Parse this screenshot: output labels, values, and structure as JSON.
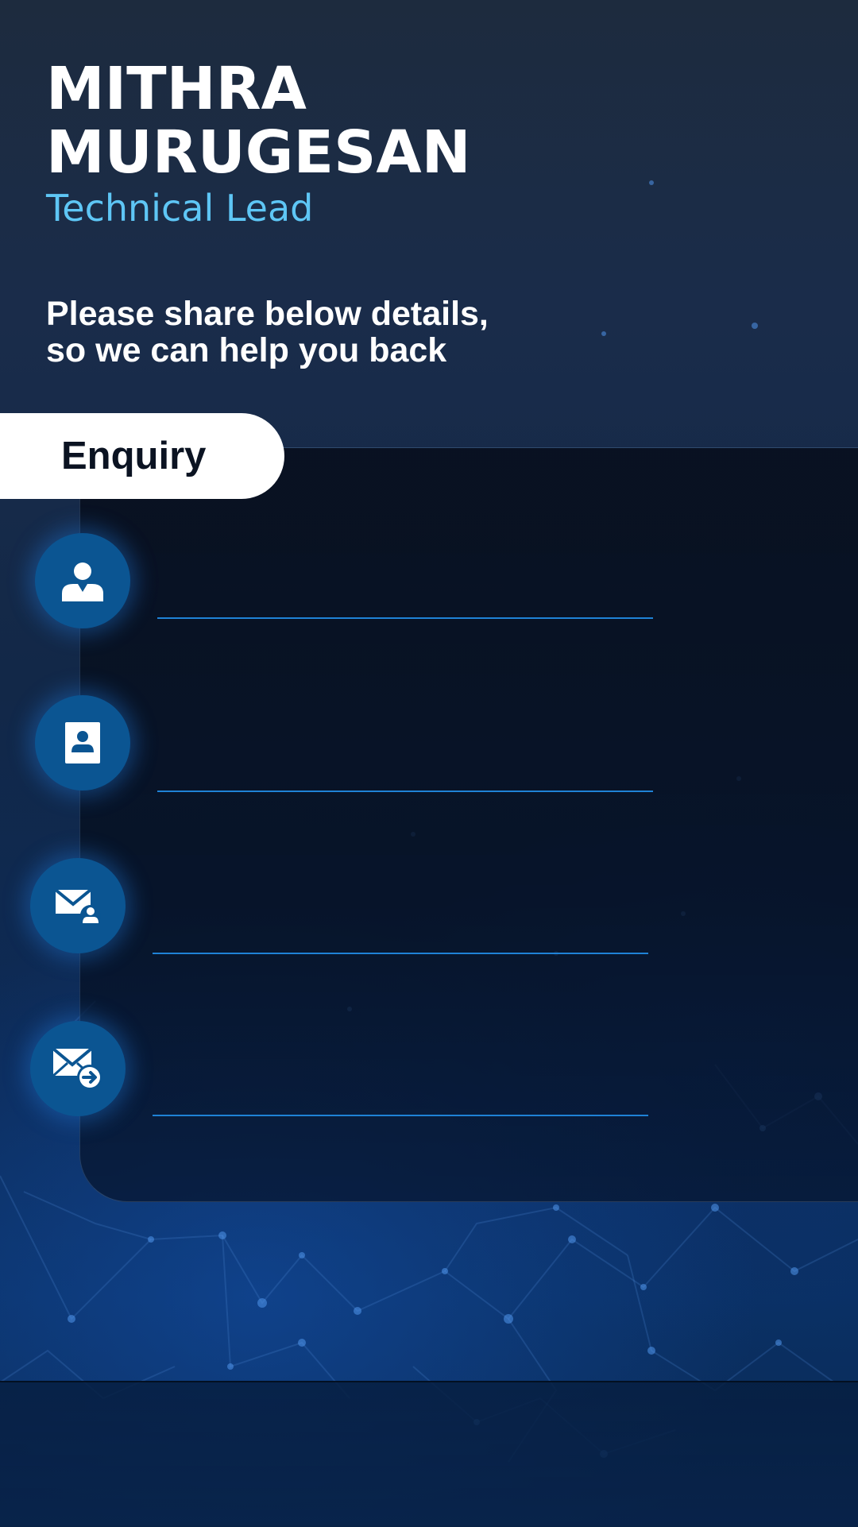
{
  "profile": {
    "first_name": "MITHRA",
    "last_name": "MURUGESAN",
    "role": "Technical Lead"
  },
  "intro": {
    "line1": "Please share below details,",
    "line2": "so we can help you back"
  },
  "form": {
    "tab_label": "Enquiry",
    "fields": [
      {
        "icon": "person-icon",
        "value": ""
      },
      {
        "icon": "contact-card-icon",
        "value": ""
      },
      {
        "icon": "email-user-icon",
        "value": ""
      },
      {
        "icon": "email-send-icon",
        "value": ""
      }
    ]
  },
  "colors": {
    "accent": "#5ec6f5",
    "icon_circle": "#0b5592",
    "underline": "#1f82d6",
    "tab_background": "#ffffff"
  }
}
